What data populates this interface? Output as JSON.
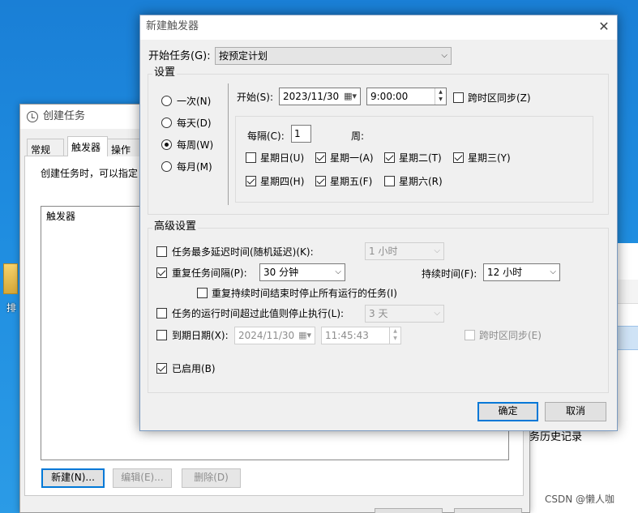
{
  "desktop": {
    "icon_label": "排"
  },
  "background_app": {
    "history_text": "务历史记录"
  },
  "create_task_window": {
    "title": "创建任务",
    "tabs": [
      "常规",
      "触发器",
      "操作"
    ],
    "description": "创建任务时，可以指定",
    "list_header": "触发器",
    "buttons": {
      "new": "新建(N)...",
      "edit": "编辑(E)...",
      "delete": "删除(D)"
    }
  },
  "new_trigger_dialog": {
    "title": "新建触发器",
    "begin_task_label": "开始任务(G):",
    "begin_task_value": "按预定计划",
    "settings_label": "设置",
    "schedule_options": [
      "一次(N)",
      "每天(D)",
      "每周(W)",
      "每月(M)"
    ],
    "selected_schedule": "每周(W)",
    "start_label": "开始(S):",
    "start_date": "2023/11/30",
    "start_time": "9:00:00",
    "sync_timezone_label": "跨时区同步(Z)",
    "recur_label": "每隔(C):",
    "recur_value": "1",
    "week_unit_label": "周:",
    "weekdays": [
      {
        "label": "星期日(U)",
        "checked": false
      },
      {
        "label": "星期一(A)",
        "checked": true
      },
      {
        "label": "星期二(T)",
        "checked": true
      },
      {
        "label": "星期三(Y)",
        "checked": true
      },
      {
        "label": "星期四(H)",
        "checked": true
      },
      {
        "label": "星期五(F)",
        "checked": true
      },
      {
        "label": "星期六(R)",
        "checked": false
      }
    ],
    "advanced_label": "高级设置",
    "delay_label": "任务最多延迟时间(随机延迟)(K):",
    "delay_value": "1 小时",
    "repeat_label": "重复任务间隔(P):",
    "repeat_value": "30 分钟",
    "duration_label": "持续时间(F):",
    "duration_value": "12 小时",
    "stop_all_label": "重复持续时间结束时停止所有运行的任务(I)",
    "stop_if_longer_label": "任务的运行时间超过此值则停止执行(L):",
    "stop_if_longer_value": "3 天",
    "expire_label": "到期日期(X):",
    "expire_date": "2024/11/30",
    "expire_time": "11:45:43",
    "expire_sync_label": "跨时区同步(E)",
    "enabled_label": "已启用(B)",
    "ok_label": "确定",
    "cancel_label": "取消"
  },
  "watermark": "CSDN @懒人咖"
}
